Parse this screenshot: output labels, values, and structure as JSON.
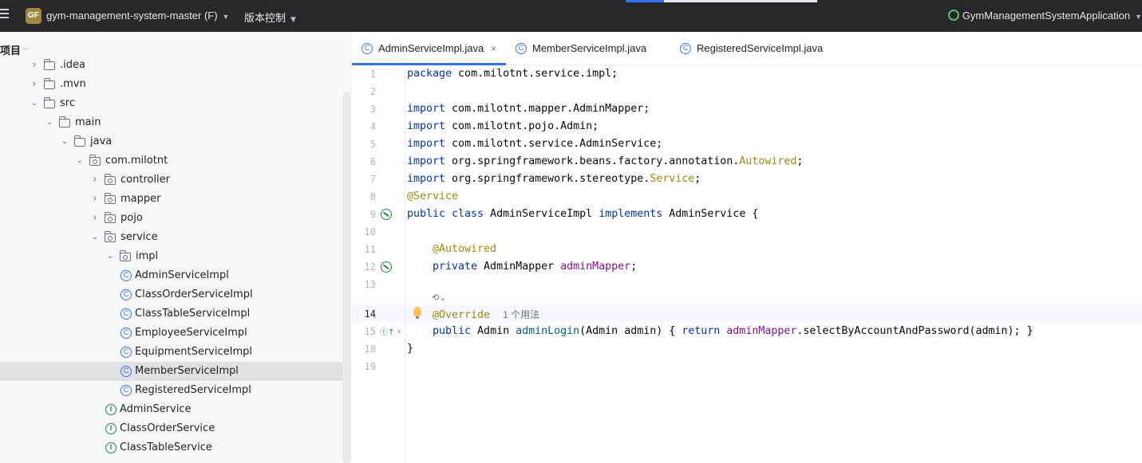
{
  "titlebar": {
    "project_badge": "GF",
    "project_name": "gym-management-system-master (F)",
    "vcs_label": "版本控制",
    "run_config": "GymManagementSystemApplication",
    "colors": {
      "background": "#27282c",
      "badge": "#9f8a45",
      "accent": "#3574f0"
    }
  },
  "project_panel": {
    "title": "项目",
    "tree": [
      {
        "label": ".idea",
        "depth": 1,
        "kind": "folder",
        "expanded": false
      },
      {
        "label": ".mvn",
        "depth": 1,
        "kind": "folder",
        "expanded": false
      },
      {
        "label": "src",
        "depth": 1,
        "kind": "folder",
        "expanded": true
      },
      {
        "label": "main",
        "depth": 2,
        "kind": "folder",
        "expanded": true
      },
      {
        "label": "java",
        "depth": 3,
        "kind": "folder",
        "expanded": true
      },
      {
        "label": "com.milotnt",
        "depth": 4,
        "kind": "package",
        "expanded": true
      },
      {
        "label": "controller",
        "depth": 5,
        "kind": "package",
        "expanded": false
      },
      {
        "label": "mapper",
        "depth": 5,
        "kind": "package",
        "expanded": false
      },
      {
        "label": "pojo",
        "depth": 5,
        "kind": "package",
        "expanded": false
      },
      {
        "label": "service",
        "depth": 5,
        "kind": "package",
        "expanded": true
      },
      {
        "label": "impl",
        "depth": 6,
        "kind": "package",
        "expanded": true
      },
      {
        "label": "AdminServiceImpl",
        "depth": 7,
        "kind": "class"
      },
      {
        "label": "ClassOrderServiceImpl",
        "depth": 7,
        "kind": "class"
      },
      {
        "label": "ClassTableServiceImpl",
        "depth": 7,
        "kind": "class"
      },
      {
        "label": "EmployeeServiceImpl",
        "depth": 7,
        "kind": "class"
      },
      {
        "label": "EquipmentServiceImpl",
        "depth": 7,
        "kind": "class"
      },
      {
        "label": "MemberServiceImpl",
        "depth": 7,
        "kind": "class",
        "selected": true
      },
      {
        "label": "RegisteredServiceImpl",
        "depth": 7,
        "kind": "class"
      },
      {
        "label": "AdminService",
        "depth": 6,
        "kind": "interface"
      },
      {
        "label": "ClassOrderService",
        "depth": 6,
        "kind": "interface"
      },
      {
        "label": "ClassTableService",
        "depth": 6,
        "kind": "interface"
      }
    ]
  },
  "tabs": [
    {
      "label": "AdminServiceImpl.java",
      "active": true,
      "close": "×"
    },
    {
      "label": "MemberServiceImpl.java",
      "active": false
    },
    {
      "label": "RegisteredServiceImpl.java",
      "active": false
    }
  ],
  "editor": {
    "line_numbers": [
      "1",
      "2",
      "3",
      "4",
      "5",
      "6",
      "7",
      "8",
      "9",
      "10",
      "11",
      "12",
      "13",
      "14",
      "15",
      "18",
      "19"
    ],
    "current_line": "14",
    "usage_hint": "1 个用法",
    "lines": {
      "l1_kw": "package",
      "l1_rest": " com.milotnt.service.impl;",
      "l3_kw": "import",
      "l3_rest": " com.milotnt.mapper.AdminMapper;",
      "l4_kw": "import",
      "l4_rest": " com.milotnt.pojo.Admin;",
      "l5_kw": "import",
      "l5_rest": " com.milotnt.service.AdminService;",
      "l6_kw": "import",
      "l6_rest": " org.springframework.beans.factory.annotation.",
      "l6_ann": "Autowired",
      "l6_end": ";",
      "l7_kw": "import",
      "l7_rest": " org.springframework.stereotype.",
      "l7_ann": "Service",
      "l7_end": ";",
      "l8_ann": "@Service",
      "l9_kw1": "public class",
      "l9_mid": " AdminServiceImpl ",
      "l9_kw2": "implements",
      "l9_end": " AdminService {",
      "l11_ann": "@Autowired",
      "l12_kw": "private",
      "l12_mid": " AdminMapper ",
      "l12_fld": "adminMapper",
      "l12_end": ";",
      "l14_ann": "@Override",
      "l15_kw": "public",
      "l15_mid": " Admin ",
      "l15_fn": "adminLogin",
      "l15_args": "(Admin admin) ",
      "l15_open": "{",
      "l15_ret": " return ",
      "l15_fld": "adminMapper",
      "l15_call": ".selectByAccountAndPassword(admin); ",
      "l15_close": "}",
      "l18": "}"
    }
  }
}
